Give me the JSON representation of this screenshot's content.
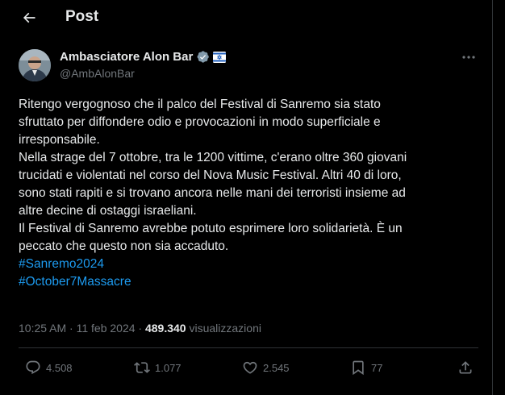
{
  "header": {
    "title": "Post"
  },
  "author": {
    "name": "Ambasciatore Alon Bar",
    "handle": "@AmbAlonBar"
  },
  "tweet": {
    "lines": [
      "Ritengo vergognoso che il palco del Festival di Sanremo sia stato",
      "sfruttato per diffondere odio e provocazioni in modo superficiale e",
      "irresponsabile.",
      "Nella strage del 7 ottobre, tra le 1200 vittime, c'erano oltre 360 giovani",
      "trucidati e violentati nel corso del Nova Music Festival. Altri 40 di loro,",
      "sono stati rapiti e si trovano ancora nelle mani dei terroristi insieme ad",
      "altre decine di ostaggi israeliani.",
      "Il Festival di Sanremo avrebbe potuto esprimere loro solidarietà. È un",
      "peccato che questo non sia accaduto."
    ],
    "hashtags": [
      "#Sanremo2024",
      "#October7Massacre"
    ]
  },
  "meta": {
    "time": "10:25 AM",
    "separator": "·",
    "date": "11 feb 2024",
    "views_count": "489.340",
    "views_label": "visualizzazioni"
  },
  "actions": {
    "replies": "4.508",
    "reposts": "1.077",
    "likes": "2.545",
    "bookmarks": "77"
  },
  "colors": {
    "background": "#000000",
    "text": "#e7e9ea",
    "secondary": "#71767b",
    "link": "#1d9bf0",
    "verified": "#829aab",
    "border": "#2f3336"
  },
  "icons": [
    "back-arrow-icon",
    "verified-badge-icon",
    "israel-flag-icon",
    "more-icon",
    "reply-icon",
    "repost-icon",
    "like-icon",
    "bookmark-icon",
    "share-icon"
  ]
}
